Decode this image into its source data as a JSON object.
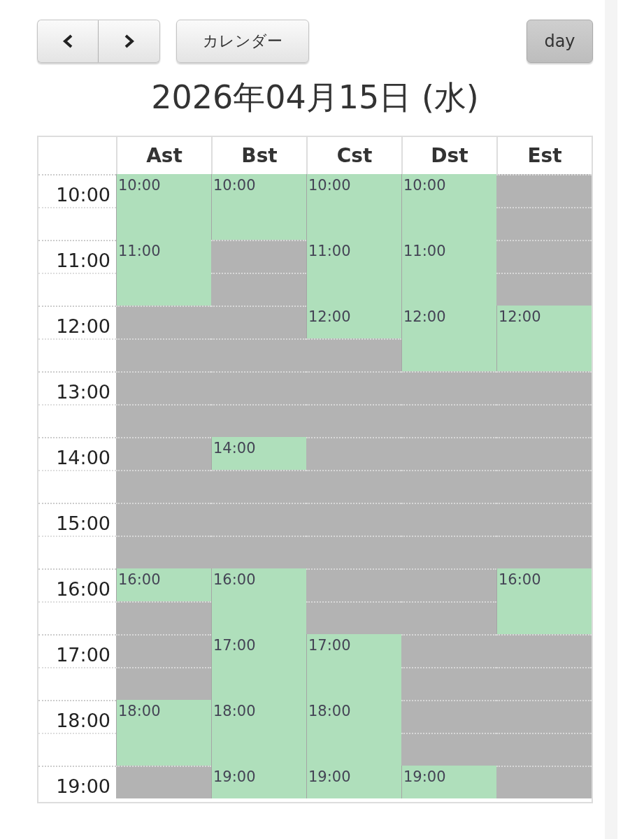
{
  "toolbar": {
    "calendar_button": "カレンダー",
    "views": [
      {
        "label": "day",
        "selected": true
      }
    ]
  },
  "title": "2026年04月15日 (水)",
  "schedule": {
    "times": [
      "10:00",
      "11:00",
      "12:00",
      "13:00",
      "14:00",
      "15:00",
      "16:00",
      "17:00",
      "18:00",
      "19:00"
    ],
    "columns": [
      {
        "name": "Ast",
        "cells": [
          {
            "available": true,
            "label": "10:00"
          },
          {
            "available": true
          },
          {
            "available": true,
            "label": "11:00"
          },
          {
            "available": true
          },
          {
            "available": false
          },
          {
            "available": false
          },
          {
            "available": false
          },
          {
            "available": false
          },
          {
            "available": false
          },
          {
            "available": false
          },
          {
            "available": false
          },
          {
            "available": false
          },
          {
            "available": true,
            "label": "16:00"
          },
          {
            "available": false
          },
          {
            "available": false
          },
          {
            "available": false
          },
          {
            "available": true,
            "label": "18:00"
          },
          {
            "available": true
          },
          {
            "available": false
          }
        ]
      },
      {
        "name": "Bst",
        "cells": [
          {
            "available": true,
            "label": "10:00"
          },
          {
            "available": true
          },
          {
            "available": false
          },
          {
            "available": false
          },
          {
            "available": false
          },
          {
            "available": false
          },
          {
            "available": false
          },
          {
            "available": false
          },
          {
            "available": true,
            "label": "14:00"
          },
          {
            "available": false
          },
          {
            "available": false
          },
          {
            "available": false
          },
          {
            "available": true,
            "label": "16:00"
          },
          {
            "available": true
          },
          {
            "available": true,
            "label": "17:00"
          },
          {
            "available": true
          },
          {
            "available": true,
            "label": "18:00"
          },
          {
            "available": true
          },
          {
            "available": true,
            "label": "19:00"
          }
        ]
      },
      {
        "name": "Cst",
        "cells": [
          {
            "available": true,
            "label": "10:00"
          },
          {
            "available": true
          },
          {
            "available": true,
            "label": "11:00"
          },
          {
            "available": true
          },
          {
            "available": true,
            "label": "12:00"
          },
          {
            "available": false
          },
          {
            "available": false
          },
          {
            "available": false
          },
          {
            "available": false
          },
          {
            "available": false
          },
          {
            "available": false
          },
          {
            "available": false
          },
          {
            "available": false
          },
          {
            "available": false
          },
          {
            "available": true,
            "label": "17:00"
          },
          {
            "available": true
          },
          {
            "available": true,
            "label": "18:00"
          },
          {
            "available": true
          },
          {
            "available": true,
            "label": "19:00"
          }
        ]
      },
      {
        "name": "Dst",
        "cells": [
          {
            "available": true,
            "label": "10:00"
          },
          {
            "available": true
          },
          {
            "available": true,
            "label": "11:00"
          },
          {
            "available": true
          },
          {
            "available": true,
            "label": "12:00"
          },
          {
            "available": true
          },
          {
            "available": false
          },
          {
            "available": false
          },
          {
            "available": false
          },
          {
            "available": false
          },
          {
            "available": false
          },
          {
            "available": false
          },
          {
            "available": false
          },
          {
            "available": false
          },
          {
            "available": false
          },
          {
            "available": false
          },
          {
            "available": false
          },
          {
            "available": false
          },
          {
            "available": true,
            "label": "19:00"
          }
        ]
      },
      {
        "name": "Est",
        "cells": [
          {
            "available": false
          },
          {
            "available": false
          },
          {
            "available": false
          },
          {
            "available": false
          },
          {
            "available": true,
            "label": "12:00"
          },
          {
            "available": true
          },
          {
            "available": false
          },
          {
            "available": false
          },
          {
            "available": false
          },
          {
            "available": false
          },
          {
            "available": false
          },
          {
            "available": false
          },
          {
            "available": true,
            "label": "16:00"
          },
          {
            "available": true
          },
          {
            "available": false
          },
          {
            "available": false
          },
          {
            "available": false
          },
          {
            "available": false
          },
          {
            "available": false
          }
        ]
      }
    ]
  }
}
